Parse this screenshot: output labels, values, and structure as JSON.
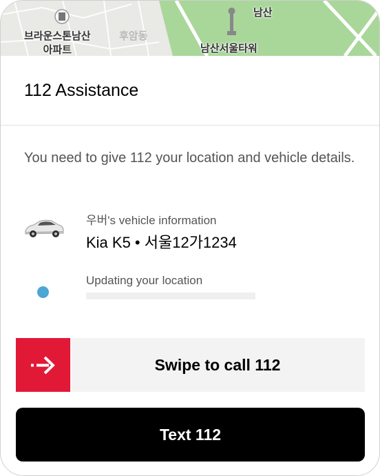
{
  "map": {
    "labels": {
      "apartment": "브라운스톤남산\n아파트",
      "apartment_line1": "브라운스톤남산",
      "apartment_line2": "아파트",
      "huam": "후암동",
      "namsan": "남산",
      "tower": "남산서울타워"
    },
    "colors": {
      "park": "#a9d79a",
      "road": "#ffffff",
      "base": "#e9e9e6"
    }
  },
  "header": {
    "title": "112 Assistance"
  },
  "description": "You need to give 112 your location and vehicle details.",
  "vehicle": {
    "caption": "우버's vehicle information",
    "value": "Kia K5 • 서울12가1234",
    "icon": "car-icon"
  },
  "location": {
    "caption": "Updating your location",
    "icon": "location-dot-icon"
  },
  "swipe": {
    "label": "Swipe to call 112",
    "icon": "arrow-right-icon",
    "accent": "#e11937"
  },
  "text_button": {
    "label": "Text 112"
  }
}
